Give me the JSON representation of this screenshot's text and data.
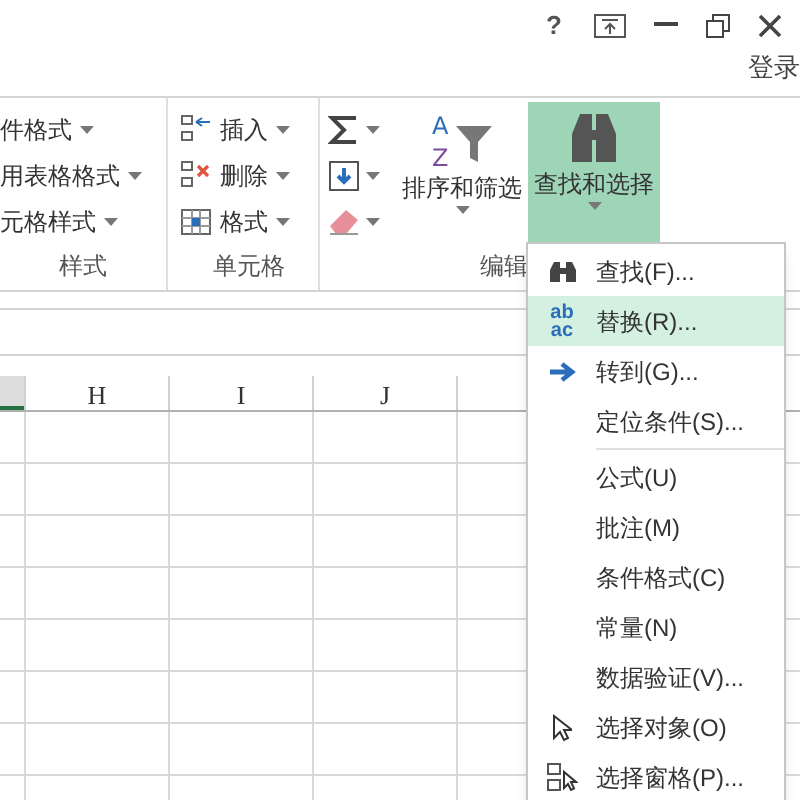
{
  "window_controls": {
    "help": "?"
  },
  "account": {
    "label": "登录"
  },
  "ribbon": {
    "styles_group": {
      "label": "样式",
      "items": [
        "件格式",
        "用表格格式",
        "元格样式"
      ]
    },
    "cells_group": {
      "label": "单元格",
      "items": [
        {
          "kind": "insert",
          "label": "插入"
        },
        {
          "kind": "delete",
          "label": "删除"
        },
        {
          "kind": "format",
          "label": "格式"
        }
      ]
    },
    "editing_group": {
      "label": "编辑",
      "small_buttons": [
        {
          "kind": "sum"
        },
        {
          "kind": "fill"
        },
        {
          "kind": "clear"
        }
      ],
      "sort_button": {
        "label": "排序和筛选",
        "icon_letters": [
          "A",
          "Z"
        ]
      },
      "find_button": {
        "label": "查找和选择",
        "selected": true
      }
    }
  },
  "columns": [
    {
      "label": "H"
    },
    {
      "label": "I"
    },
    {
      "label": "J"
    }
  ],
  "menu": {
    "items": [
      {
        "kind": "find",
        "label": "查找(F)...",
        "selected": false
      },
      {
        "kind": "replace",
        "label": "替换(R)...",
        "selected": true,
        "icon_text": [
          "ab",
          "ac"
        ]
      },
      {
        "kind": "goto",
        "label": "转到(G)...",
        "selected": false
      },
      {
        "kind": "plain",
        "label": "定位条件(S)...",
        "selected": false
      },
      {
        "kind": "separator"
      },
      {
        "kind": "plain",
        "label": "公式(U)",
        "selected": false
      },
      {
        "kind": "plain",
        "label": "批注(M)",
        "selected": false
      },
      {
        "kind": "plain",
        "label": "条件格式(C)",
        "selected": false
      },
      {
        "kind": "plain",
        "label": "常量(N)",
        "selected": false
      },
      {
        "kind": "plain",
        "label": "数据验证(V)...",
        "selected": false
      },
      {
        "kind": "pointer",
        "label": "选择对象(O)",
        "selected": false
      },
      {
        "kind": "pane",
        "label": "选择窗格(P)...",
        "selected": false
      }
    ]
  }
}
